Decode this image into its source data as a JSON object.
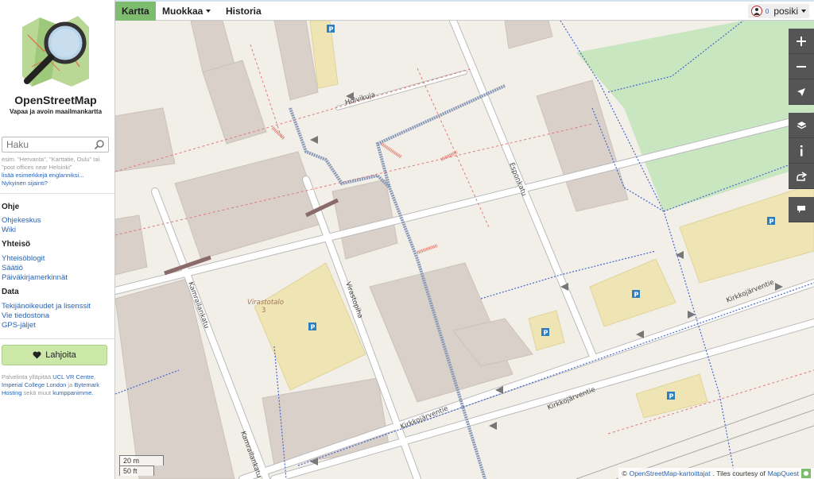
{
  "site": {
    "title": "OpenStreetMap",
    "tagline": "Vapaa ja avoin maailmankartta"
  },
  "search": {
    "placeholder": "Haku",
    "hint_examples": "esim. \"Hervanta\", \"Karttatie, Oulu\" tai \"post offices near Helsinki\"",
    "hint_more": "lisää esimerkkejä englanniksi...",
    "where_am_i": "Nykyinen sijainti?"
  },
  "sections": {
    "help": {
      "heading": "Ohje",
      "links": [
        "Ohjekeskus",
        "Wiki"
      ]
    },
    "community": {
      "heading": "Yhteisö",
      "links": [
        "Yhteisöblogit",
        "Säätiö",
        "Päiväkirjamerkinnät"
      ]
    },
    "data": {
      "heading": "Data",
      "links": [
        "Tekijänoikeudet ja lisenssit",
        "Vie tiedostona",
        "GPS-jäljet"
      ]
    }
  },
  "donate": {
    "label": "Lahjoita"
  },
  "hosting": {
    "prefix": "Palvelinta ylläpitää",
    "ucl": "UCL VR Centre",
    "imperial": "Imperial College London",
    "and": "ja",
    "bytemark": "Bytemark Hosting",
    "suffix": "sekä muut",
    "partners": "kumppanimme."
  },
  "nav": {
    "map": "Kartta",
    "edit": "Muokkaa",
    "history": "Historia"
  },
  "user": {
    "notifications": "0",
    "name": "posiki"
  },
  "map": {
    "streets": {
      "holvikuja": "Holvikuja",
      "esponkatu": "Esponkatu",
      "kamreerintie": "Virastopiha",
      "kamrerintie": "Kamreerintie",
      "kirkkojarventie": "Kirkkojärventie",
      "kamrailankatu": "Kamrailankatu",
      "virastotalo": "Virastotalo",
      "virastotalo_no": "3"
    },
    "parking": "P",
    "scale": {
      "metric": "20 m",
      "imperial": "50 ft"
    }
  },
  "attribution": {
    "copyright": "©",
    "osm": "OpenStreetMap-kartoittajat",
    "tiles": ". Tiles courtesy of",
    "mapquest": "MapQuest"
  },
  "colors": {
    "nav_active": "#7ebc6f",
    "donate_bg": "#cbe8a9",
    "link": "#2a64b5",
    "map_bg": "#f2efe9",
    "building": "#d9d0c9",
    "park": "#c8e6c0",
    "parking": "#efe4b4"
  }
}
